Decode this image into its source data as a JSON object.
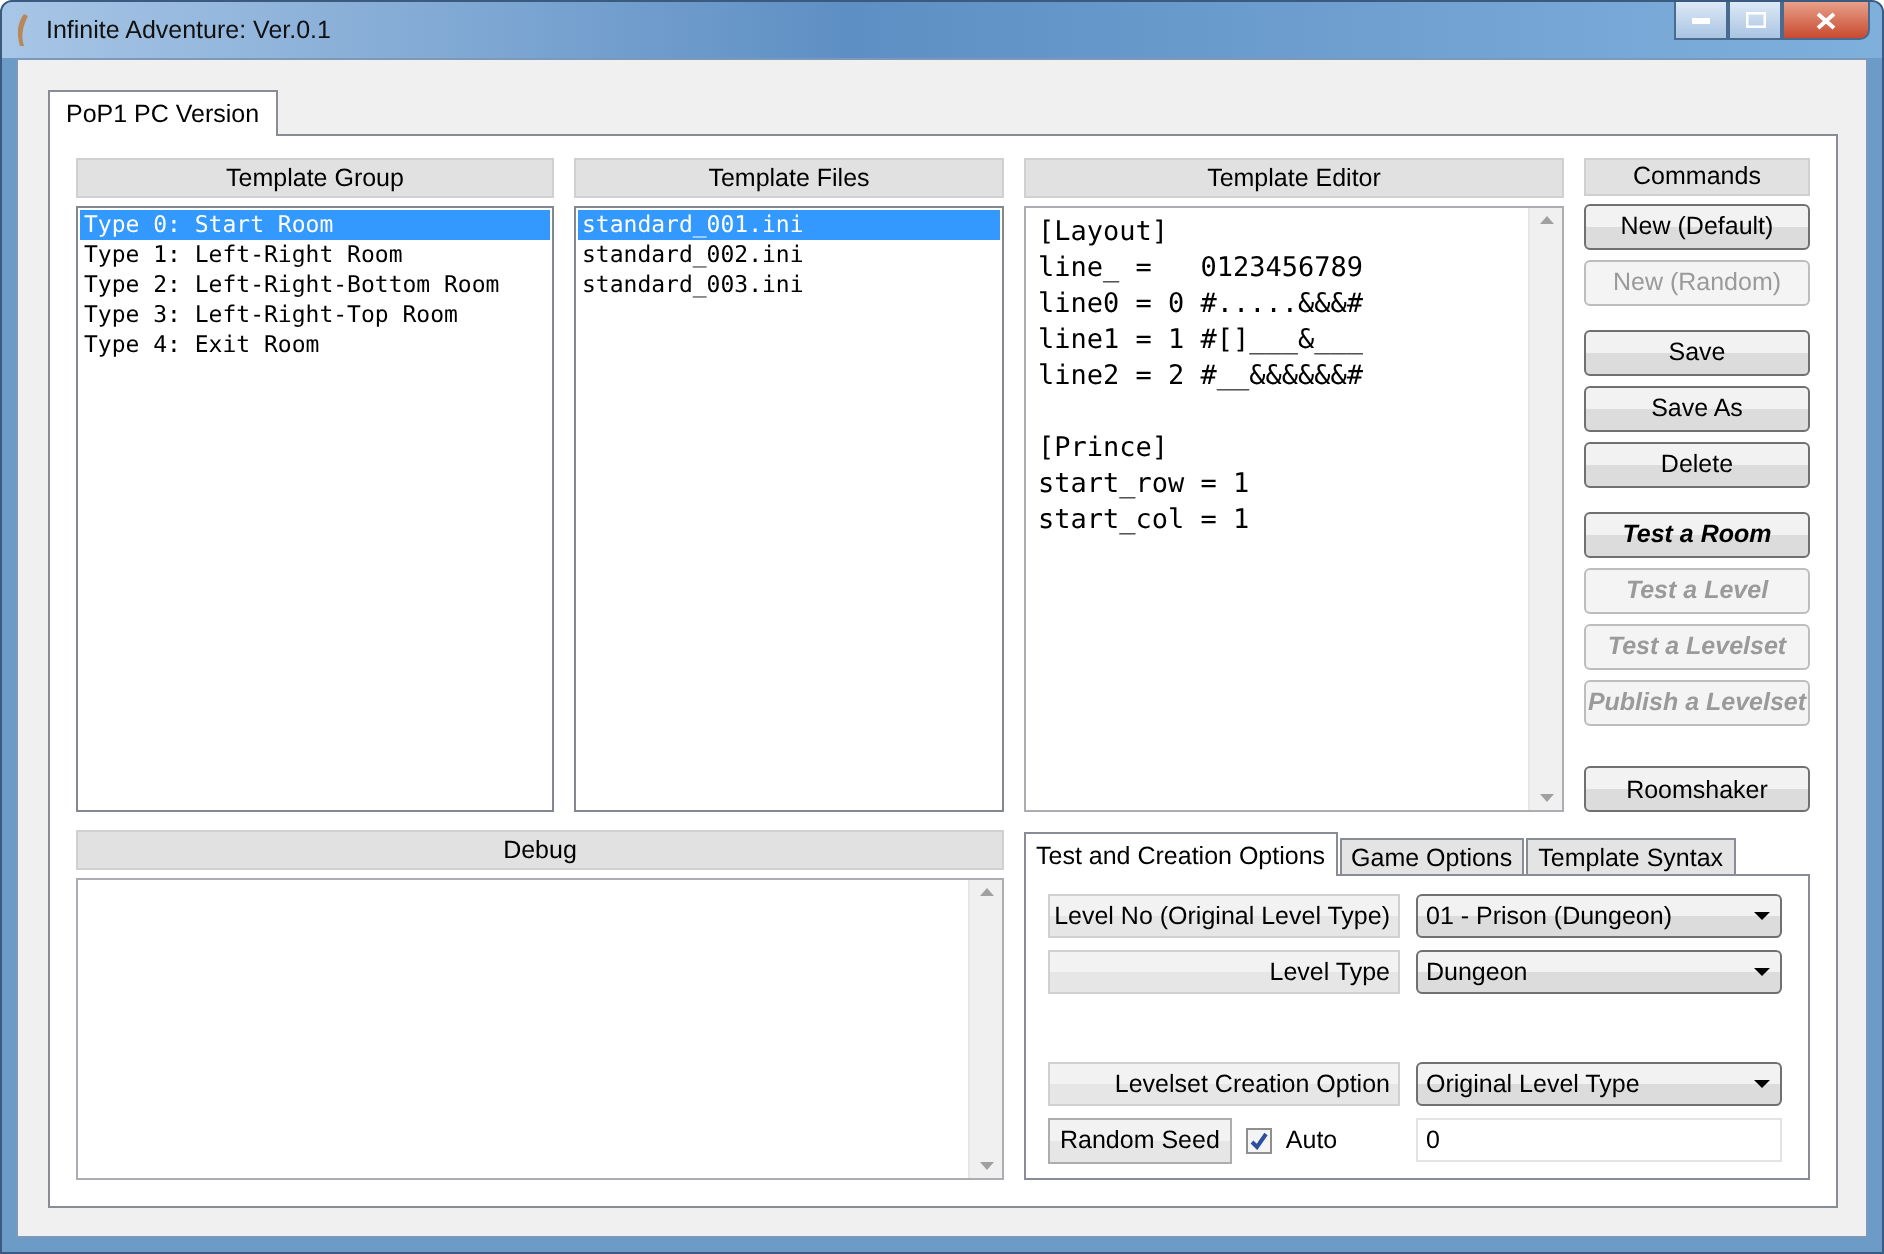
{
  "window": {
    "title": "Infinite Adventure: Ver.0.1"
  },
  "tabs": [
    {
      "label": "PoP1 PC Version",
      "selected": true
    }
  ],
  "template_group": {
    "header": "Template Group",
    "items": [
      {
        "label": "Type 0: Start Room",
        "selected": true
      },
      {
        "label": "Type 1: Left-Right Room",
        "selected": false
      },
      {
        "label": "Type 2: Left-Right-Bottom Room",
        "selected": false
      },
      {
        "label": "Type 3: Left-Right-Top Room",
        "selected": false
      },
      {
        "label": "Type 4: Exit Room",
        "selected": false
      }
    ]
  },
  "template_files": {
    "header": "Template Files",
    "items": [
      {
        "label": "standard_001.ini",
        "selected": true
      },
      {
        "label": "standard_002.ini",
        "selected": false
      },
      {
        "label": "standard_003.ini",
        "selected": false
      }
    ]
  },
  "template_editor": {
    "header": "Template Editor",
    "sections": [
      [
        "[Layout]",
        "line_ =   0123456789",
        "line0 = 0 #.....&&&#",
        "line1 = 1 #[]___&___",
        "line2 = 2 #__&&&&&&#"
      ],
      [
        "[Prince]",
        "start_row = 1",
        "start_col = 1"
      ]
    ]
  },
  "commands": {
    "header": "Commands",
    "groups": [
      [
        {
          "label": "New (Default)",
          "disabled": false,
          "emphasis": false
        },
        {
          "label": "New (Random)",
          "disabled": true,
          "emphasis": false
        }
      ],
      [
        {
          "label": "Save",
          "disabled": false,
          "emphasis": false
        },
        {
          "label": "Save As",
          "disabled": false,
          "emphasis": false
        },
        {
          "label": "Delete",
          "disabled": false,
          "emphasis": false
        }
      ],
      [
        {
          "label": "Test a Room",
          "disabled": false,
          "emphasis": true
        },
        {
          "label": "Test a Level",
          "disabled": true,
          "emphasis": true
        },
        {
          "label": "Test a Levelset",
          "disabled": true,
          "emphasis": true
        },
        {
          "label": "Publish a Levelset",
          "disabled": true,
          "emphasis": true
        }
      ],
      [
        {
          "label": "Roomshaker",
          "disabled": false,
          "emphasis": false
        }
      ]
    ]
  },
  "debug": {
    "header": "Debug"
  },
  "options": {
    "tabs": [
      {
        "label": "Test and Creation Options",
        "selected": true
      },
      {
        "label": "Game Options",
        "selected": false
      },
      {
        "label": "Template Syntax",
        "selected": false
      }
    ],
    "rows": [
      {
        "label": "Level No (Original Level Type)",
        "value": "01 - Prison (Dungeon)"
      },
      {
        "label": "Level Type",
        "value": "Dungeon"
      },
      {
        "label": "Levelset Creation Option",
        "value": "Original Level Type"
      }
    ],
    "seed": {
      "button": "Random Seed",
      "auto_label": "Auto",
      "auto_checked": true,
      "value": "0"
    }
  }
}
